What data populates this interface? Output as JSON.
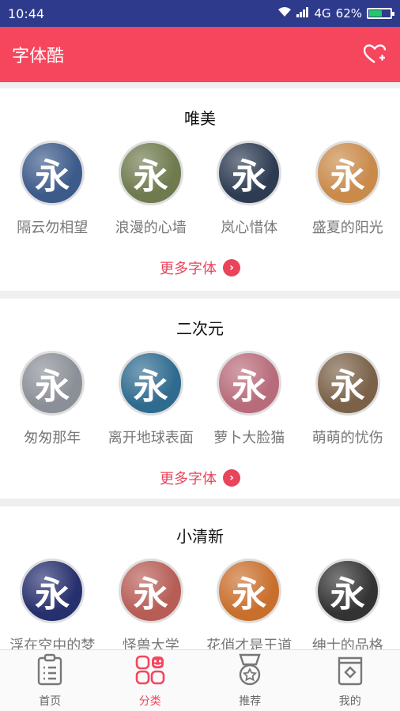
{
  "status": {
    "time": "10:44",
    "network": "4G",
    "battery": "62%",
    "battery_level": 0.62
  },
  "header": {
    "title": "字体酷"
  },
  "sections": [
    {
      "title": "唯美",
      "more": "更多字体",
      "items": [
        {
          "name": "隔云勿相望",
          "glyph": "永",
          "bg": "#3c5a8a"
        },
        {
          "name": "浪漫的心墙",
          "glyph": "永",
          "bg": "#6f7a4e"
        },
        {
          "name": "岚心惜体",
          "glyph": "永",
          "bg": "#2d3c52"
        },
        {
          "name": "盛夏的阳光",
          "glyph": "永",
          "bg": "#c98a4a"
        }
      ]
    },
    {
      "title": "二次元",
      "more": "更多字体",
      "items": [
        {
          "name": "匆匆那年",
          "glyph": "永",
          "bg": "#8b8f97"
        },
        {
          "name": "离开地球表面",
          "glyph": "永",
          "bg": "#2f6b8f"
        },
        {
          "name": "萝卜大脸猫",
          "glyph": "永",
          "bg": "#b86b7a"
        },
        {
          "name": "萌萌的忧伤",
          "glyph": "永",
          "bg": "#7a6148"
        }
      ]
    },
    {
      "title": "小清新",
      "more": "更多字体",
      "items": [
        {
          "name": "浮在空中的梦",
          "glyph": "永",
          "bg": "#27306e"
        },
        {
          "name": "怪兽大学",
          "glyph": "永",
          "bg": "#b75d56"
        },
        {
          "name": "花俏才是王道",
          "glyph": "永",
          "bg": "#c96f2c"
        },
        {
          "name": "绅士的品格",
          "glyph": "永",
          "bg": "#333333"
        }
      ]
    }
  ],
  "tabs": [
    {
      "label": "首页",
      "icon": "clipboard-icon",
      "active": false
    },
    {
      "label": "分类",
      "icon": "grid-icon",
      "active": true
    },
    {
      "label": "推荐",
      "icon": "medal-icon",
      "active": false
    },
    {
      "label": "我的",
      "icon": "profile-card-icon",
      "active": false
    }
  ],
  "colors": {
    "accent": "#f5465d",
    "status_bar": "#2e3a8c"
  }
}
